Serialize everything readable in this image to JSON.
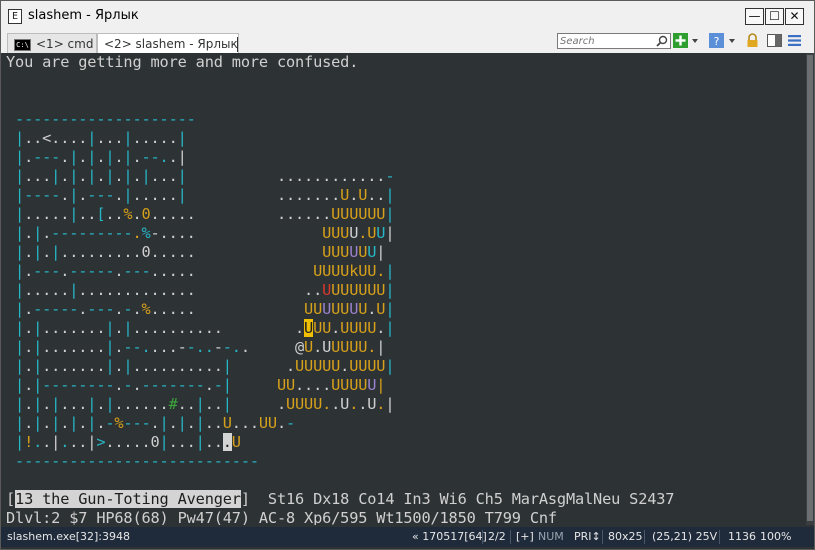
{
  "window": {
    "title": "slashem - Ярлык",
    "app_icon_glyph": "E",
    "minimize_glyph": "—",
    "maximize_glyph": "☐",
    "close_glyph": "✕"
  },
  "tabs": [
    {
      "label": "<1> cmd",
      "icon_text": "C:\\",
      "active": false
    },
    {
      "label": "<2> slashem - Ярлык",
      "active": true
    }
  ],
  "toolbar": {
    "search_placeholder": "Search",
    "icons": [
      "search-icon",
      "add-console-icon",
      "dropdown-arrow-icon",
      "help-icon",
      "dropdown-arrow-icon",
      "lock-icon",
      "split-view-icon",
      "menu-icon"
    ],
    "add_color": "#2e9e2e",
    "help_color": "#5b8fd8"
  },
  "terminal": {
    "background": "#2d3235",
    "palette": {
      "w": "#d0d0d0",
      "c": "#27b6c6",
      "y": "#d6a01b",
      "p": "#9b82cc",
      "r": "#d9382f",
      "g": "#3aa83a",
      "hl": "#f0c000",
      "inv_bg": "#d4d4d4",
      "inv_fg": "#1e1e1e"
    },
    "lines": [
      "You are getting more and more confused.",
      "",
      "",
      " --------------------",
      " |..<....|...|.....|",
      " |.---.|.|.|.|.--..|",
      " |...|.|.|.|.|.|...|          ............-",
      " |----.|.---.|.....|          .......U.U..|",
      " |.....|..[..%.0.....         ......UUUUUU|",
      " |.|.---------.%-....              UUUU.UU|",
      " |.|.|.........0.....              UUUUUU|",
      " |.---.-----.---.....             UUUUkUU.|",
      " |.....|.............            ..UUUUUUU|",
      " |.-----.---.-.%.....            UUUUUUU.U|",
      " |.|.......|.|..........        .UUU.UUUU.|",
      " |.|.......|.--....--..--..     @U.UUUUU.|",
      " |.|.......|.|..........|      .UUUUU.UUUU|",
      " |.|--------.-.-------.-|     UU....UUUUU|",
      " |.|.|...|.|......#..|..|     .UUUU..U..U.|",
      " |.|.|.|.|.-%---.|.|.|..U...UU.-",
      " |!..|...|>.....0|...|...U",
      " ---------------------------",
      "",
      "[13 the Gun-Toting Avenger]  St16 Dx18 Co14 In3 Wi6 Ch5 MarAsgMalNeu S2437",
      "Dlvl:2 $7 HP68(68) Pw47(47) AC-8 Xp6/595 Wt1500/1850 T799 Cnf"
    ],
    "colors": [
      "wwwwwwwwwwwwwwwwwwwwwwwwwwwwwwwwwwwwwww",
      "",
      "",
      " cccccccccccccccccccc",
      " cwwwwwwwcwwwcwwwwwc",
      " cwcccwcwcwcwcwcccwwc",
      " cwwwcwcwcwcwcwcwwwc          wwwwwwwwwwwwc",
      " cccccwcwcccwcwwwwwc          wwwwwwwywywwc",
      " cwwwwwcwwcwwywywwwww         wwwwwwyyyyyyc",
      " cwcwcccccccccycwwww              yyyywyyc",
      " cwcwcwwwwwwwwwwwwww              yyyypyc",
      " cwcccwcccccwcccwwwww             yyyyyyyyc",
      " cwwwwwcwwwwwwwwwwww             wwryyyyyyc",
      " cwcccccwcccwcwywwwww            yypyypywyc",
      " cwcwwwwwwwcwcwwwwwwwwww        whyywyyyywc",
      " cwcwwwwwwwcwcccwwwwcccwccww     ywwyyyyywc",
      " cwcwwwwwwwcwcwwwwwwwwwwc      wyyyyywyyyyc",
      " cwcccccccccwcwcccccccwcc     yywwwwyyyypyc",
      " cwcwcwwwcwcwwwwwwgwwcwwc     wyyyyywwywwywc",
      " cwcwcwcwcwcycccwcwcwcwwywwwyywc",
      " cycwwcwwwcwwwwwwcwwwcwwwy",
      " ccccccccccccccccccccccccccc",
      "",
      "",
      ""
    ],
    "inverse_segment": "13 the Gun-Toting Avenger",
    "highlight_cell": {
      "row": 14,
      "col": 32
    },
    "cursor_cell": {
      "row": 20,
      "col": 24
    }
  },
  "statusbar": {
    "process": "slashem.exe[32]:3948",
    "build": "« 170517[64]",
    "console_index": "2/2",
    "plus": "[+]",
    "num": "NUM",
    "priority": "PRI↕",
    "size": "80x25",
    "cursor_pos": "(25,21) 25V",
    "pid": "1136",
    "zoom": "100%"
  }
}
